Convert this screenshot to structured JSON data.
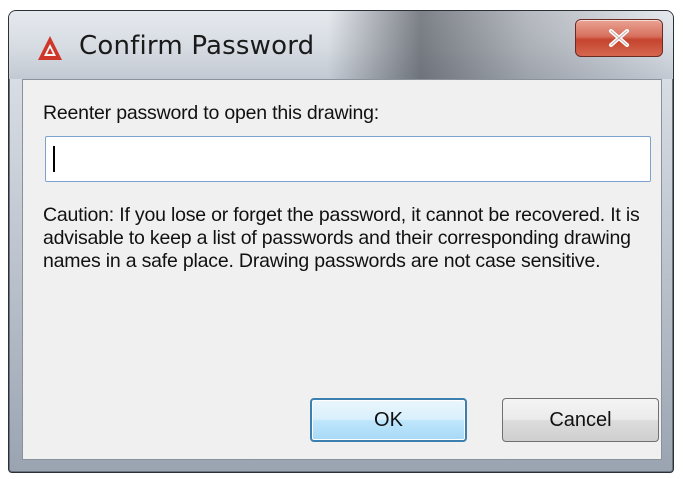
{
  "window": {
    "title": "Confirm Password",
    "icon": "autocad-logo-icon",
    "close_icon": "close-icon"
  },
  "dialog": {
    "prompt": "Reenter password to open this drawing:",
    "password_value": "",
    "caution": "Caution: If you lose or forget the password, it cannot be recovered.  It is advisable to keep a list of passwords and their corresponding drawing names in a safe place.  Drawing passwords are not case sensitive.",
    "ok_label": "OK",
    "cancel_label": "Cancel"
  },
  "colors": {
    "accent": "#3c7fb1",
    "close_button": "#c5452f",
    "app_icon": "#d0352a"
  }
}
